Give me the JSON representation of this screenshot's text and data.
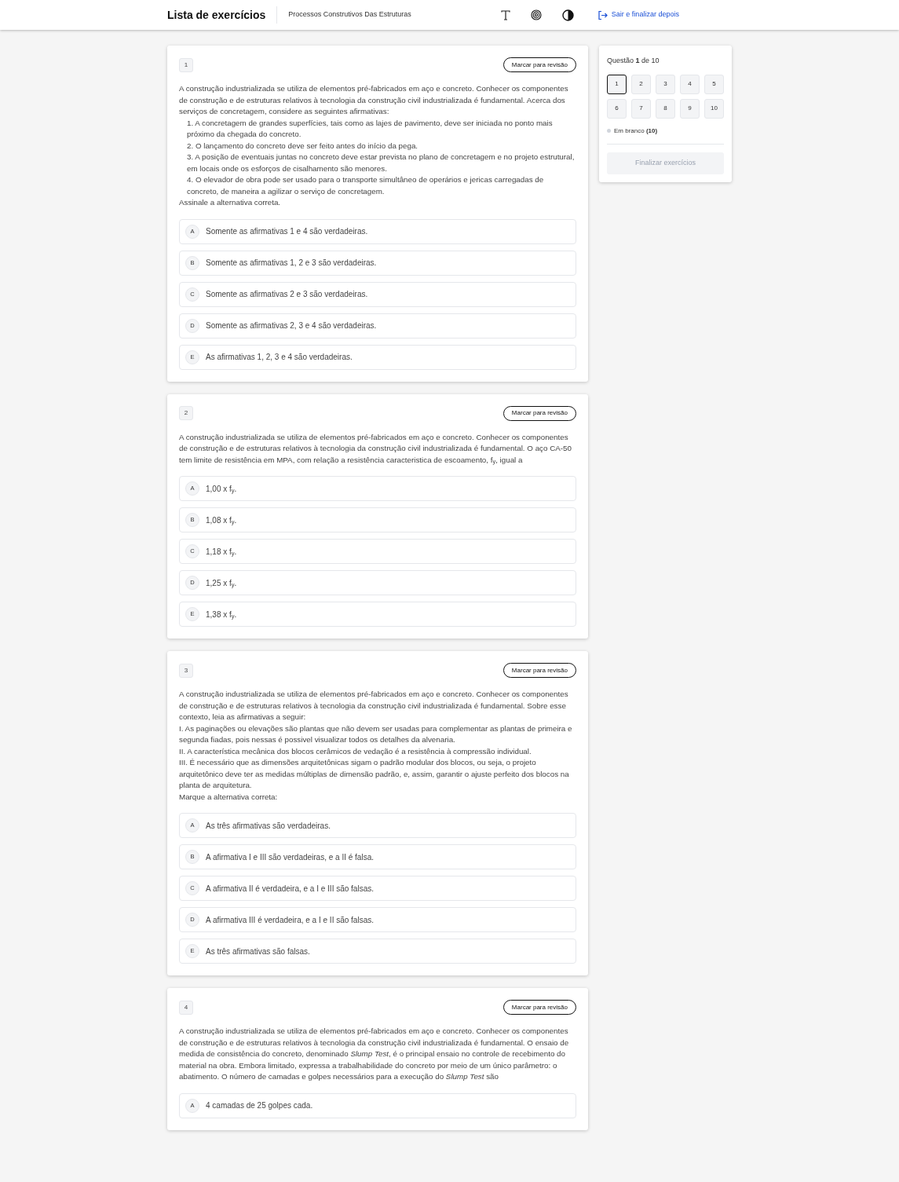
{
  "header": {
    "title": "Lista de exercícios",
    "subtitle": "Processos Construtivos Das Estruturas",
    "exit_link": "Sair e finalizar depois"
  },
  "questions": [
    {
      "number": "1",
      "review_button": "Marcar para revisão",
      "statement": [
        {
          "kind": "paragraph",
          "text": "A construção industrializada se utiliza de elementos pré-fabricados em aço e concreto. Conhecer os componentes de construção e de estruturas relativos à tecnologia da construção civil industrializada é fundamental. Acerca dos serviços de concretagem, considere as seguintes afirmativas:"
        },
        {
          "kind": "item",
          "text": "1. A concretagem de grandes superfícies, tais como as lajes de pavimento, deve ser iniciada no ponto mais próximo da chegada do concreto."
        },
        {
          "kind": "item",
          "text": "2. O lançamento do concreto deve ser feito antes do início da pega."
        },
        {
          "kind": "item",
          "text": "3. A posição de eventuais juntas no concreto deve estar prevista no plano de concretagem e no projeto estrutural, em locais onde os esforços de cisalhamento são menores."
        },
        {
          "kind": "item",
          "text": "4. O elevador de obra pode ser usado para o transporte simultâneo de operários e jericas carregadas de concreto, de maneira a agilizar o serviço de concretagem."
        },
        {
          "kind": "paragraph",
          "text": "Assinale a alternativa correta."
        }
      ],
      "options": [
        {
          "letter": "A",
          "text": "Somente as afirmativas 1 e 4 são verdadeiras."
        },
        {
          "letter": "B",
          "text": "Somente as afirmativas 1, 2 e 3 são verdadeiras."
        },
        {
          "letter": "C",
          "text": "Somente as afirmativas 2 e 3 são verdadeiras."
        },
        {
          "letter": "D",
          "text": "Somente as afirmativas 2, 3 e 4 são verdadeiras."
        },
        {
          "letter": "E",
          "text": "As afirmativas 1, 2, 3 e 4 são verdadeiras."
        }
      ]
    },
    {
      "number": "2",
      "review_button": "Marcar para revisão",
      "statement": [
        {
          "kind": "paragraph",
          "text": "A construção industrializada se utiliza de elementos pré-fabricados em aço e concreto. Conhecer os componentes de construção e de estruturas relativos à tecnologia da construção civil industrializada é fundamental. O aço CA-50 tem limite de resistência em MPA, com relação a resistência caracteristica de escoamento, f$_{y}$, igual a"
        }
      ],
      "options": [
        {
          "letter": "A",
          "text": "1,00 x f$_{y}$."
        },
        {
          "letter": "B",
          "text": "1,08 x f$_{y}$."
        },
        {
          "letter": "C",
          "text": "1,18 x f$_{y}$."
        },
        {
          "letter": "D",
          "text": "1,25 x f$_{y}$."
        },
        {
          "letter": "E",
          "text": "1,38 x f$_{y}$."
        }
      ]
    },
    {
      "number": "3",
      "review_button": "Marcar para revisão",
      "statement": [
        {
          "kind": "paragraph",
          "text": "A construção industrializada se utiliza de elementos pré-fabricados em aço e concreto. Conhecer os componentes de construção e de estruturas relativos à tecnologia da construção civil industrializada é fundamental. Sobre esse contexto, leia as afirmativas a seguir:"
        },
        {
          "kind": "paragraph",
          "text": "I. As paginações ou elevações são plantas que não devem ser usadas para complementar as plantas de primeira e segunda fiadas, pois nessas é possivel visualizar todos os detalhes da alvenaria."
        },
        {
          "kind": "paragraph",
          "text": "II. A característica mecânica dos blocos cerâmicos de vedação é a resistência à compressão individual."
        },
        {
          "kind": "paragraph",
          "text": "III. É necessário que as dimensões arquitetônicas sigam o padrão modular dos blocos, ou seja, o projeto arquitetônico deve ter as medidas múltiplas de dimensão padrão, e, assim, garantir o ajuste perfeito dos blocos na planta de arquitetura."
        },
        {
          "kind": "paragraph",
          "text": "Marque a alternativa correta:"
        }
      ],
      "options": [
        {
          "letter": "A",
          "text": "As três afirmativas são verdadeiras."
        },
        {
          "letter": "B",
          "text": "A afirmativa I e III são verdadeiras, e a II é falsa."
        },
        {
          "letter": "C",
          "text": "A afirmativa II é verdadeira, e a I e III são falsas."
        },
        {
          "letter": "D",
          "text": "A afirmativa III é verdadeira, e a I e II são falsas."
        },
        {
          "letter": "E",
          "text": "As três afirmativas são falsas."
        }
      ]
    },
    {
      "number": "4",
      "review_button": "Marcar para revisão",
      "statement": [
        {
          "kind": "paragraph",
          "text": "A construção industrializada se utiliza de elementos pré-fabricados em aço e concreto. Conhecer os componentes de construção e de estruturas relativos à tecnologia da construção civil industrializada é fundamental. O ensaio de medida de consistência do concreto, denominado *Slump Test*, é o principal ensaio no controle de recebimento do material na obra. Embora limitado, expressa a trabalhabilidade do concreto por meio de um único parâmetro: o abatimento. O número de camadas e golpes necessários para a execução do *Slump Test* são"
        }
      ],
      "options": [
        {
          "letter": "A",
          "text": "4 camadas de 25 golpes cada."
        }
      ]
    }
  ],
  "sidebar": {
    "progress": "Questão **1** de 10",
    "numbers": [
      {
        "label": "1",
        "selected": true
      },
      {
        "label": "2",
        "selected": false
      },
      {
        "label": "3",
        "selected": false
      },
      {
        "label": "4",
        "selected": false
      },
      {
        "label": "5",
        "selected": false
      },
      {
        "label": "6",
        "selected": false
      },
      {
        "label": "7",
        "selected": false
      },
      {
        "label": "8",
        "selected": false
      },
      {
        "label": "9",
        "selected": false
      },
      {
        "label": "10",
        "selected": false
      }
    ],
    "legend": "Em branco **(10)**",
    "finish_button": {
      "label": "Finalizar exercícios",
      "disabled": true
    }
  }
}
